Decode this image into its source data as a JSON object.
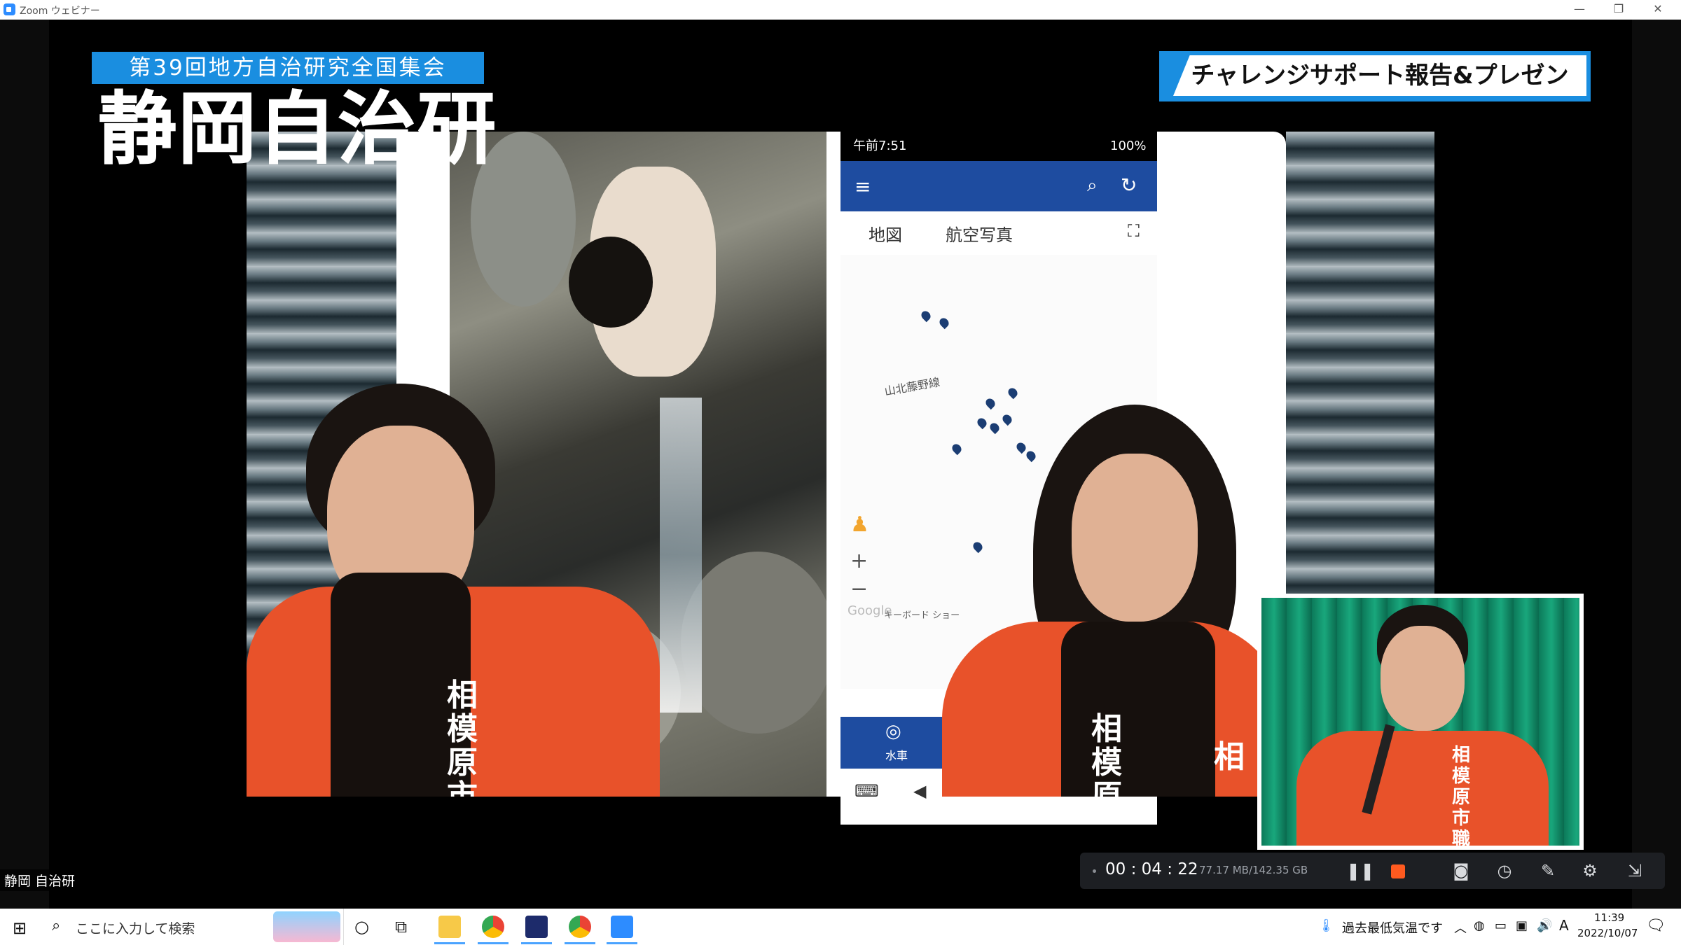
{
  "window": {
    "title": "Zoom ウェビナー",
    "controls": [
      "—",
      "❐",
      "✕"
    ]
  },
  "banner": {
    "event": "第39回地方自治研究全国集会",
    "group": "静岡自治研",
    "session": "チャレンジサポート報告&プレゼン"
  },
  "phone": {
    "time": "午前7:51",
    "battery": "100%",
    "tabs": [
      "地図",
      "航空写真"
    ],
    "map_label": "山北藤野線",
    "keyboard_hint": "キーボード ショー",
    "google": "Google",
    "bottom_label": "水車"
  },
  "happi": {
    "text_left": "相模原市",
    "text_right": "相模原",
    "text_right2": "相",
    "text_tile": "相模原市職"
  },
  "participant": {
    "name": "静岡 自治研"
  },
  "recorder": {
    "elapsed": "00 : 04 : 22",
    "size": "77.17 MB/142.35 GB",
    "icons": [
      "pause-icon",
      "stop-icon",
      "camera-icon",
      "timer-icon",
      "draw-icon",
      "gear-icon",
      "minimize-icon"
    ]
  },
  "taskbar": {
    "search_placeholder": "ここに入力して検索",
    "weather": "過去最低気温です",
    "time": "11:39",
    "date": "2022/10/07",
    "ime": "A"
  },
  "colors": {
    "accent": "#1a8ee0",
    "happi": "#e8522a",
    "appbar": "#1e4ca0",
    "zoom": "#2D8CFF"
  }
}
